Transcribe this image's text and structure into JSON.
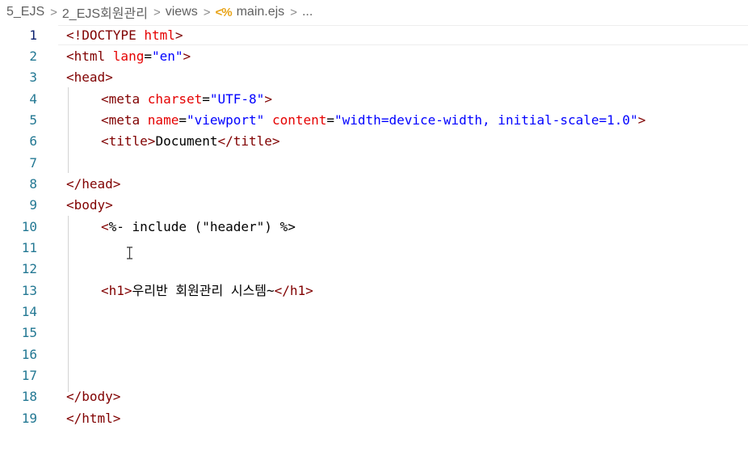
{
  "breadcrumb": {
    "items": [
      "5_EJS",
      "2_EJS회원관리",
      "views",
      "main.ejs",
      "..."
    ],
    "separator": ">",
    "file_icon": "ejs-file-icon"
  },
  "editor": {
    "active_line": 1,
    "lines": [
      {
        "n": "1",
        "indent": 0,
        "tokens": [
          {
            "t": "tag",
            "v": "<!DOCTYPE "
          },
          {
            "t": "attr",
            "v": "html"
          },
          {
            "t": "tag",
            "v": ">"
          }
        ]
      },
      {
        "n": "2",
        "indent": 0,
        "tokens": [
          {
            "t": "tag",
            "v": "<html "
          },
          {
            "t": "attr",
            "v": "lang"
          },
          {
            "t": "txt",
            "v": "="
          },
          {
            "t": "val",
            "v": "\"en\""
          },
          {
            "t": "tag",
            "v": ">"
          }
        ]
      },
      {
        "n": "3",
        "indent": 0,
        "tokens": [
          {
            "t": "tag",
            "v": "<head>"
          }
        ]
      },
      {
        "n": "4",
        "indent": 1,
        "tokens": [
          {
            "t": "tag",
            "v": "<meta "
          },
          {
            "t": "attr",
            "v": "charset"
          },
          {
            "t": "txt",
            "v": "="
          },
          {
            "t": "val",
            "v": "\"UTF-8\""
          },
          {
            "t": "tag",
            "v": ">"
          }
        ]
      },
      {
        "n": "5",
        "indent": 1,
        "tokens": [
          {
            "t": "tag",
            "v": "<meta "
          },
          {
            "t": "attr",
            "v": "name"
          },
          {
            "t": "txt",
            "v": "="
          },
          {
            "t": "val",
            "v": "\"viewport\""
          },
          {
            "t": "txt",
            "v": " "
          },
          {
            "t": "attr",
            "v": "content"
          },
          {
            "t": "txt",
            "v": "="
          },
          {
            "t": "val",
            "v": "\"width=device-width, initial-scale=1.0\""
          },
          {
            "t": "tag",
            "v": ">"
          }
        ]
      },
      {
        "n": "6",
        "indent": 1,
        "tokens": [
          {
            "t": "tag",
            "v": "<title>"
          },
          {
            "t": "txt",
            "v": "Document"
          },
          {
            "t": "tag",
            "v": "</title>"
          }
        ]
      },
      {
        "n": "7",
        "indent": 0,
        "tokens": []
      },
      {
        "n": "8",
        "indent": 0,
        "tokens": [
          {
            "t": "tag",
            "v": "</head>"
          }
        ]
      },
      {
        "n": "9",
        "indent": 0,
        "tokens": [
          {
            "t": "tag",
            "v": "<body>"
          }
        ]
      },
      {
        "n": "10",
        "indent": 1,
        "tokens": [
          {
            "t": "ejs",
            "v": "<"
          },
          {
            "t": "txt",
            "v": "%- include (\"header\") %>"
          }
        ]
      },
      {
        "n": "11",
        "indent": 0,
        "tokens": []
      },
      {
        "n": "12",
        "indent": 0,
        "tokens": []
      },
      {
        "n": "13",
        "indent": 1,
        "tokens": [
          {
            "t": "tag",
            "v": "<h1>"
          },
          {
            "t": "txt",
            "v": "우리반 회원관리 시스템~"
          },
          {
            "t": "tag",
            "v": "</h1>"
          }
        ]
      },
      {
        "n": "14",
        "indent": 0,
        "tokens": []
      },
      {
        "n": "15",
        "indent": 0,
        "tokens": []
      },
      {
        "n": "16",
        "indent": 0,
        "tokens": []
      },
      {
        "n": "17",
        "indent": 0,
        "tokens": []
      },
      {
        "n": "18",
        "indent": 0,
        "tokens": [
          {
            "t": "tag",
            "v": "</body>"
          }
        ]
      },
      {
        "n": "19",
        "indent": 0,
        "tokens": [
          {
            "t": "tag",
            "v": "</html>"
          }
        ]
      }
    ]
  },
  "colors": {
    "tag": "#800000",
    "attr": "#e50000",
    "value": "#0000ff",
    "line_number": "#237893",
    "active_line_number": "#0b216f"
  }
}
